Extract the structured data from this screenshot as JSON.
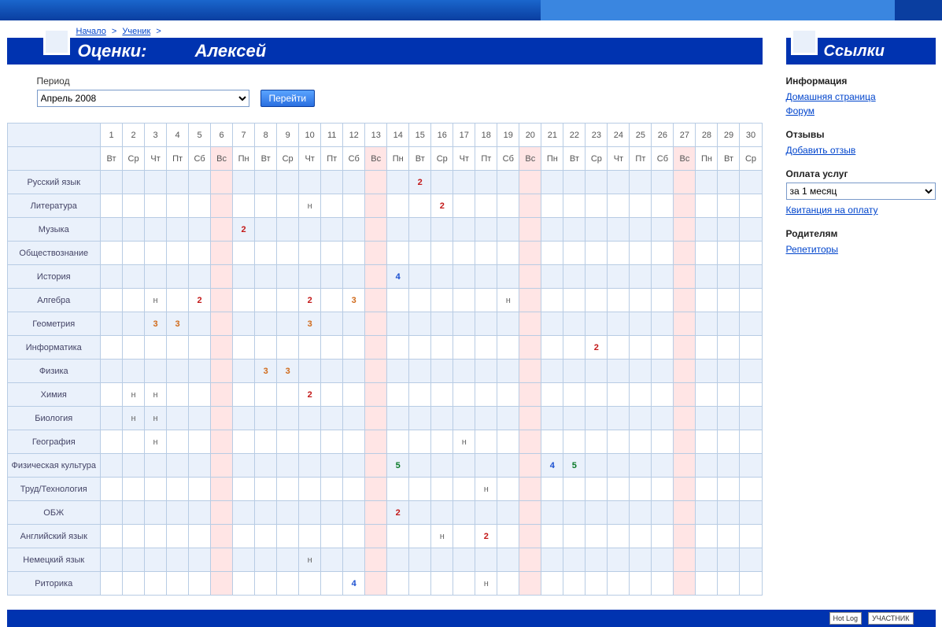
{
  "breadcrumb": {
    "home": "Начало",
    "student": "Ученик"
  },
  "title": {
    "prefix": "Оценки:",
    "name": "Алексей"
  },
  "period": {
    "label": "Период",
    "selected": "Апрель 2008",
    "button": "Перейти"
  },
  "calendar": {
    "days": [
      1,
      2,
      3,
      4,
      5,
      6,
      7,
      8,
      9,
      10,
      11,
      12,
      13,
      14,
      15,
      16,
      17,
      18,
      19,
      20,
      21,
      22,
      23,
      24,
      25,
      26,
      27,
      28,
      29,
      30
    ],
    "dow": [
      "Вт",
      "Ср",
      "Чт",
      "Пт",
      "Сб",
      "Вс",
      "Пн",
      "Вт",
      "Ср",
      "Чт",
      "Пт",
      "Сб",
      "Вс",
      "Пн",
      "Вт",
      "Ср",
      "Чт",
      "Пт",
      "Сб",
      "Вс",
      "Пн",
      "Вт",
      "Ср",
      "Чт",
      "Пт",
      "Сб",
      "Вс",
      "Пн",
      "Вт",
      "Ср"
    ],
    "sundays": [
      6,
      13,
      20,
      27
    ]
  },
  "subjects": [
    {
      "name": "Русский язык",
      "marks": {
        "15": "2"
      }
    },
    {
      "name": "Литература",
      "marks": {
        "10": "н",
        "16": "2"
      }
    },
    {
      "name": "Музыка",
      "marks": {
        "7": "2"
      }
    },
    {
      "name": "Обществознание",
      "marks": {}
    },
    {
      "name": "История",
      "marks": {
        "14": "4"
      }
    },
    {
      "name": "Алгебра",
      "marks": {
        "3": "н",
        "5": "2",
        "10": "2",
        "12": "3",
        "19": "н"
      }
    },
    {
      "name": "Геометрия",
      "marks": {
        "3": "3",
        "4": "3",
        "10": "3"
      }
    },
    {
      "name": "Информатика",
      "marks": {
        "23": "2"
      }
    },
    {
      "name": "Физика",
      "marks": {
        "8": "3",
        "9": "3"
      }
    },
    {
      "name": "Химия",
      "marks": {
        "2": "н",
        "3": "н",
        "10": "2"
      }
    },
    {
      "name": "Биология",
      "marks": {
        "2": "н",
        "3": "н"
      }
    },
    {
      "name": "География",
      "marks": {
        "3": "н",
        "17": "н"
      }
    },
    {
      "name": "Физическая культура",
      "marks": {
        "14": "5",
        "21": "4",
        "22": "5"
      }
    },
    {
      "name": "Труд/Технология",
      "marks": {
        "18": "н"
      }
    },
    {
      "name": "ОБЖ",
      "marks": {
        "14": "2"
      }
    },
    {
      "name": "Английский язык",
      "marks": {
        "16": "н",
        "18": "2"
      }
    },
    {
      "name": "Немецкий язык",
      "marks": {
        "10": "н"
      }
    },
    {
      "name": "Риторика",
      "marks": {
        "12": "4",
        "18": "н"
      }
    }
  ],
  "sidebar": {
    "title": "Ссылки",
    "info": {
      "header": "Информация",
      "links": [
        "Домашняя страница",
        "Форум"
      ]
    },
    "reviews": {
      "header": "Отзывы",
      "links": [
        "Добавить отзыв"
      ]
    },
    "pay": {
      "header": "Оплата услуг",
      "select": "за 1 месяц",
      "links": [
        "Квитанция на оплату"
      ]
    },
    "parents": {
      "header": "Родителям",
      "links": [
        "Репетиторы"
      ]
    }
  },
  "footer": {
    "badge1": "Hot Log",
    "badge2": "УЧАСТНИК"
  }
}
